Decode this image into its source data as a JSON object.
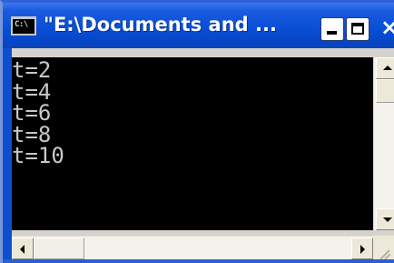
{
  "window": {
    "title": "\"E:\\Documents and ...",
    "icon": "console-window-icon",
    "icon_text": "C:\\"
  },
  "titlebar_buttons": {
    "minimize": "minimize-icon",
    "maximize": "maximize-icon",
    "close": "close-icon",
    "close_glyph": "×"
  },
  "console": {
    "lines": [
      "t=2",
      "t=4",
      "t=6",
      "t=8",
      "t=10"
    ],
    "text_color": "#c8c8c8",
    "background": "#000000"
  },
  "scrollbars": {
    "vertical": {
      "up": "scroll-up-arrow-icon",
      "down": "scroll-down-arrow-icon"
    },
    "horizontal": {
      "left": "scroll-left-arrow-icon",
      "right": "scroll-right-arrow-icon"
    }
  },
  "colors": {
    "titlebar": "#0a4fd6",
    "frame": "#0c4fcf"
  }
}
